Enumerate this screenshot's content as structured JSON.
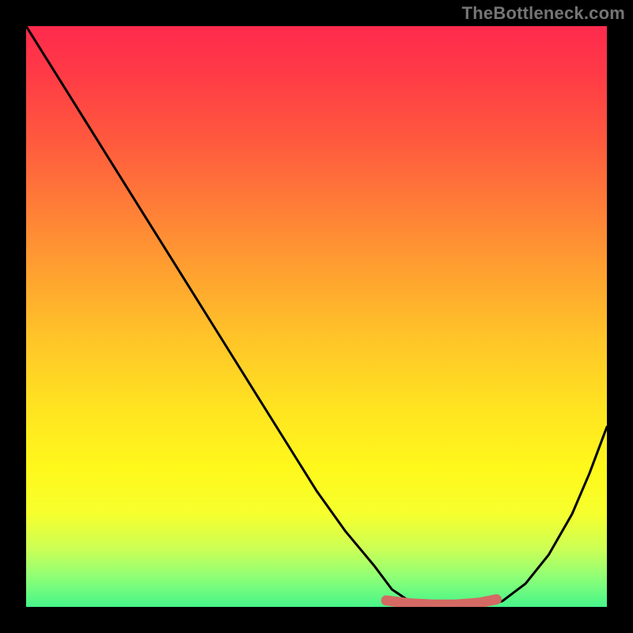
{
  "watermark": "TheBottleneck.com",
  "chart_data": {
    "type": "line",
    "title": "",
    "xlabel": "",
    "ylabel": "",
    "xlim": [
      0,
      100
    ],
    "ylim": [
      0,
      100
    ],
    "series": [
      {
        "name": "bottleneck-curve",
        "x": [
          0,
          5,
          10,
          15,
          20,
          25,
          30,
          35,
          40,
          45,
          50,
          55,
          60,
          63,
          66,
          70,
          74,
          78,
          82,
          86,
          90,
          94,
          97,
          100
        ],
        "y": [
          100,
          92,
          84,
          76,
          68,
          60,
          52,
          44,
          36,
          28,
          20,
          13,
          7,
          3,
          1,
          0,
          0,
          0,
          1,
          4,
          9,
          16,
          23,
          31
        ]
      },
      {
        "name": "optimal-marker",
        "x": [
          62,
          66,
          70,
          74,
          78,
          81
        ],
        "y": [
          1.1,
          0.6,
          0.4,
          0.4,
          0.7,
          1.3
        ]
      }
    ],
    "gradient_stops": [
      {
        "pos": 0,
        "color": "#ff2a4d"
      },
      {
        "pos": 50,
        "color": "#ffc528"
      },
      {
        "pos": 80,
        "color": "#fff81b"
      },
      {
        "pos": 100,
        "color": "#46f58a"
      }
    ],
    "marker_color": "#d46a63"
  }
}
